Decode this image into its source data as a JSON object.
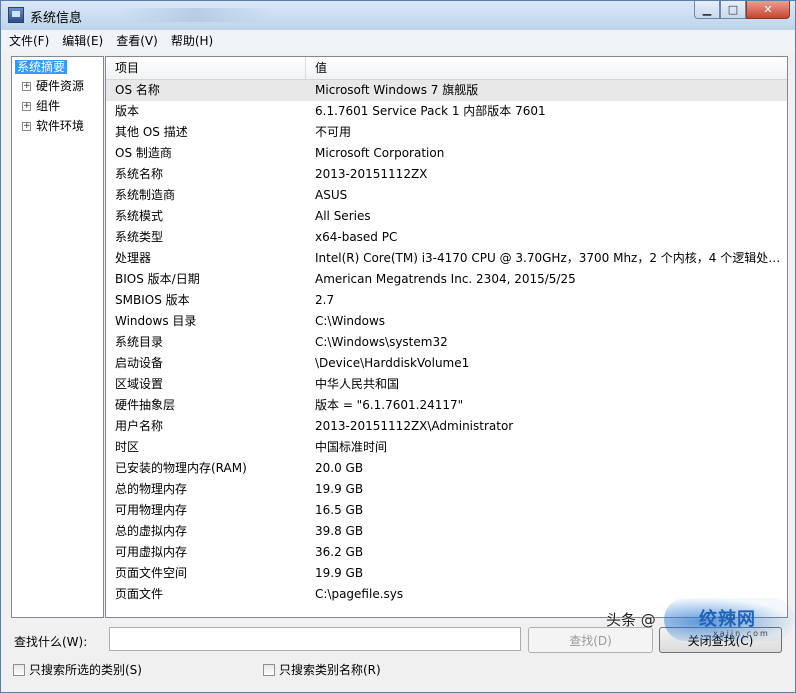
{
  "window": {
    "title": "系统信息",
    "caption": {
      "minimize": "▁",
      "maximize": "□",
      "close": "✕"
    }
  },
  "menu": [
    "文件(F)",
    "编辑(E)",
    "查看(V)",
    "帮助(H)"
  ],
  "tree": {
    "selected": "系统摘要",
    "children": [
      "硬件资源",
      "组件",
      "软件环境"
    ]
  },
  "list": {
    "headers": {
      "item": "项目",
      "value": "值"
    },
    "rows": [
      {
        "item": "OS 名称",
        "value": "Microsoft Windows 7 旗舰版"
      },
      {
        "item": "版本",
        "value": "6.1.7601 Service Pack 1 内部版本 7601"
      },
      {
        "item": "其他 OS 描述",
        "value": "不可用"
      },
      {
        "item": "OS 制造商",
        "value": "Microsoft Corporation"
      },
      {
        "item": "系统名称",
        "value": "2013-20151112ZX"
      },
      {
        "item": "系统制造商",
        "value": "ASUS"
      },
      {
        "item": "系统模式",
        "value": "All Series"
      },
      {
        "item": "系统类型",
        "value": "x64-based PC"
      },
      {
        "item": "处理器",
        "value": "Intel(R) Core(TM) i3-4170 CPU @ 3.70GHz，3700 Mhz，2 个内核，4 个逻辑处理..."
      },
      {
        "item": "BIOS 版本/日期",
        "value": "American Megatrends Inc. 2304, 2015/5/25"
      },
      {
        "item": "SMBIOS 版本",
        "value": "2.7"
      },
      {
        "item": "Windows 目录",
        "value": "C:\\Windows"
      },
      {
        "item": "系统目录",
        "value": "C:\\Windows\\system32"
      },
      {
        "item": "启动设备",
        "value": "\\Device\\HarddiskVolume1"
      },
      {
        "item": "区域设置",
        "value": "中华人民共和国"
      },
      {
        "item": "硬件抽象层",
        "value": "版本 = \"6.1.7601.24117\""
      },
      {
        "item": "用户名称",
        "value": "2013-20151112ZX\\Administrator"
      },
      {
        "item": "时区",
        "value": "中国标准时间"
      },
      {
        "item": "已安装的物理内存(RAM)",
        "value": "20.0 GB"
      },
      {
        "item": "总的物理内存",
        "value": "19.9 GB"
      },
      {
        "item": "可用物理内存",
        "value": "16.5 GB"
      },
      {
        "item": "总的虚拟内存",
        "value": "39.8 GB"
      },
      {
        "item": "可用虚拟内存",
        "value": "36.2 GB"
      },
      {
        "item": "页面文件空间",
        "value": "19.9 GB"
      },
      {
        "item": "页面文件",
        "value": "C:\\pagefile.sys"
      }
    ]
  },
  "search": {
    "label": "查找什么(W):",
    "value": "",
    "find_button": "查找(D)",
    "close_find_button": "关闭查找(C)",
    "only_selected_category": "只搜索所选的类别(S)",
    "only_category_names": "只搜索类别名称(R)"
  },
  "watermark": {
    "text": "头条 @",
    "logo_text": "绞辣网",
    "url": "xajjn.com"
  }
}
